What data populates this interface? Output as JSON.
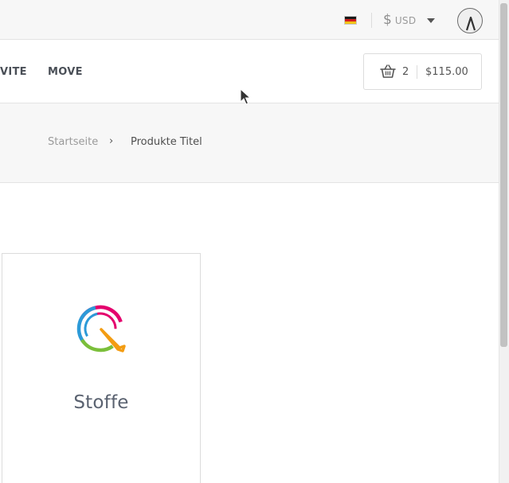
{
  "topbar": {
    "language_flag": "germany-flag",
    "currency_symbol": "$",
    "currency_code": "USD"
  },
  "nav": {
    "items": [
      {
        "label": "VITE"
      },
      {
        "label": "MOVE"
      }
    ]
  },
  "cart": {
    "count": "2",
    "total": "$115.00"
  },
  "breadcrumb": {
    "home": "Startseite",
    "separator": "›",
    "current": "Produkte Titel"
  },
  "product": {
    "title": "Stoffe",
    "logo_colors": [
      "#e4006d",
      "#2c9ad8",
      "#7bbf3a",
      "#f39c12"
    ]
  },
  "colors": {
    "topbar_bg": "#f7f7f7",
    "text_dark": "#4a4f57",
    "text_muted": "#9a9a9a"
  }
}
